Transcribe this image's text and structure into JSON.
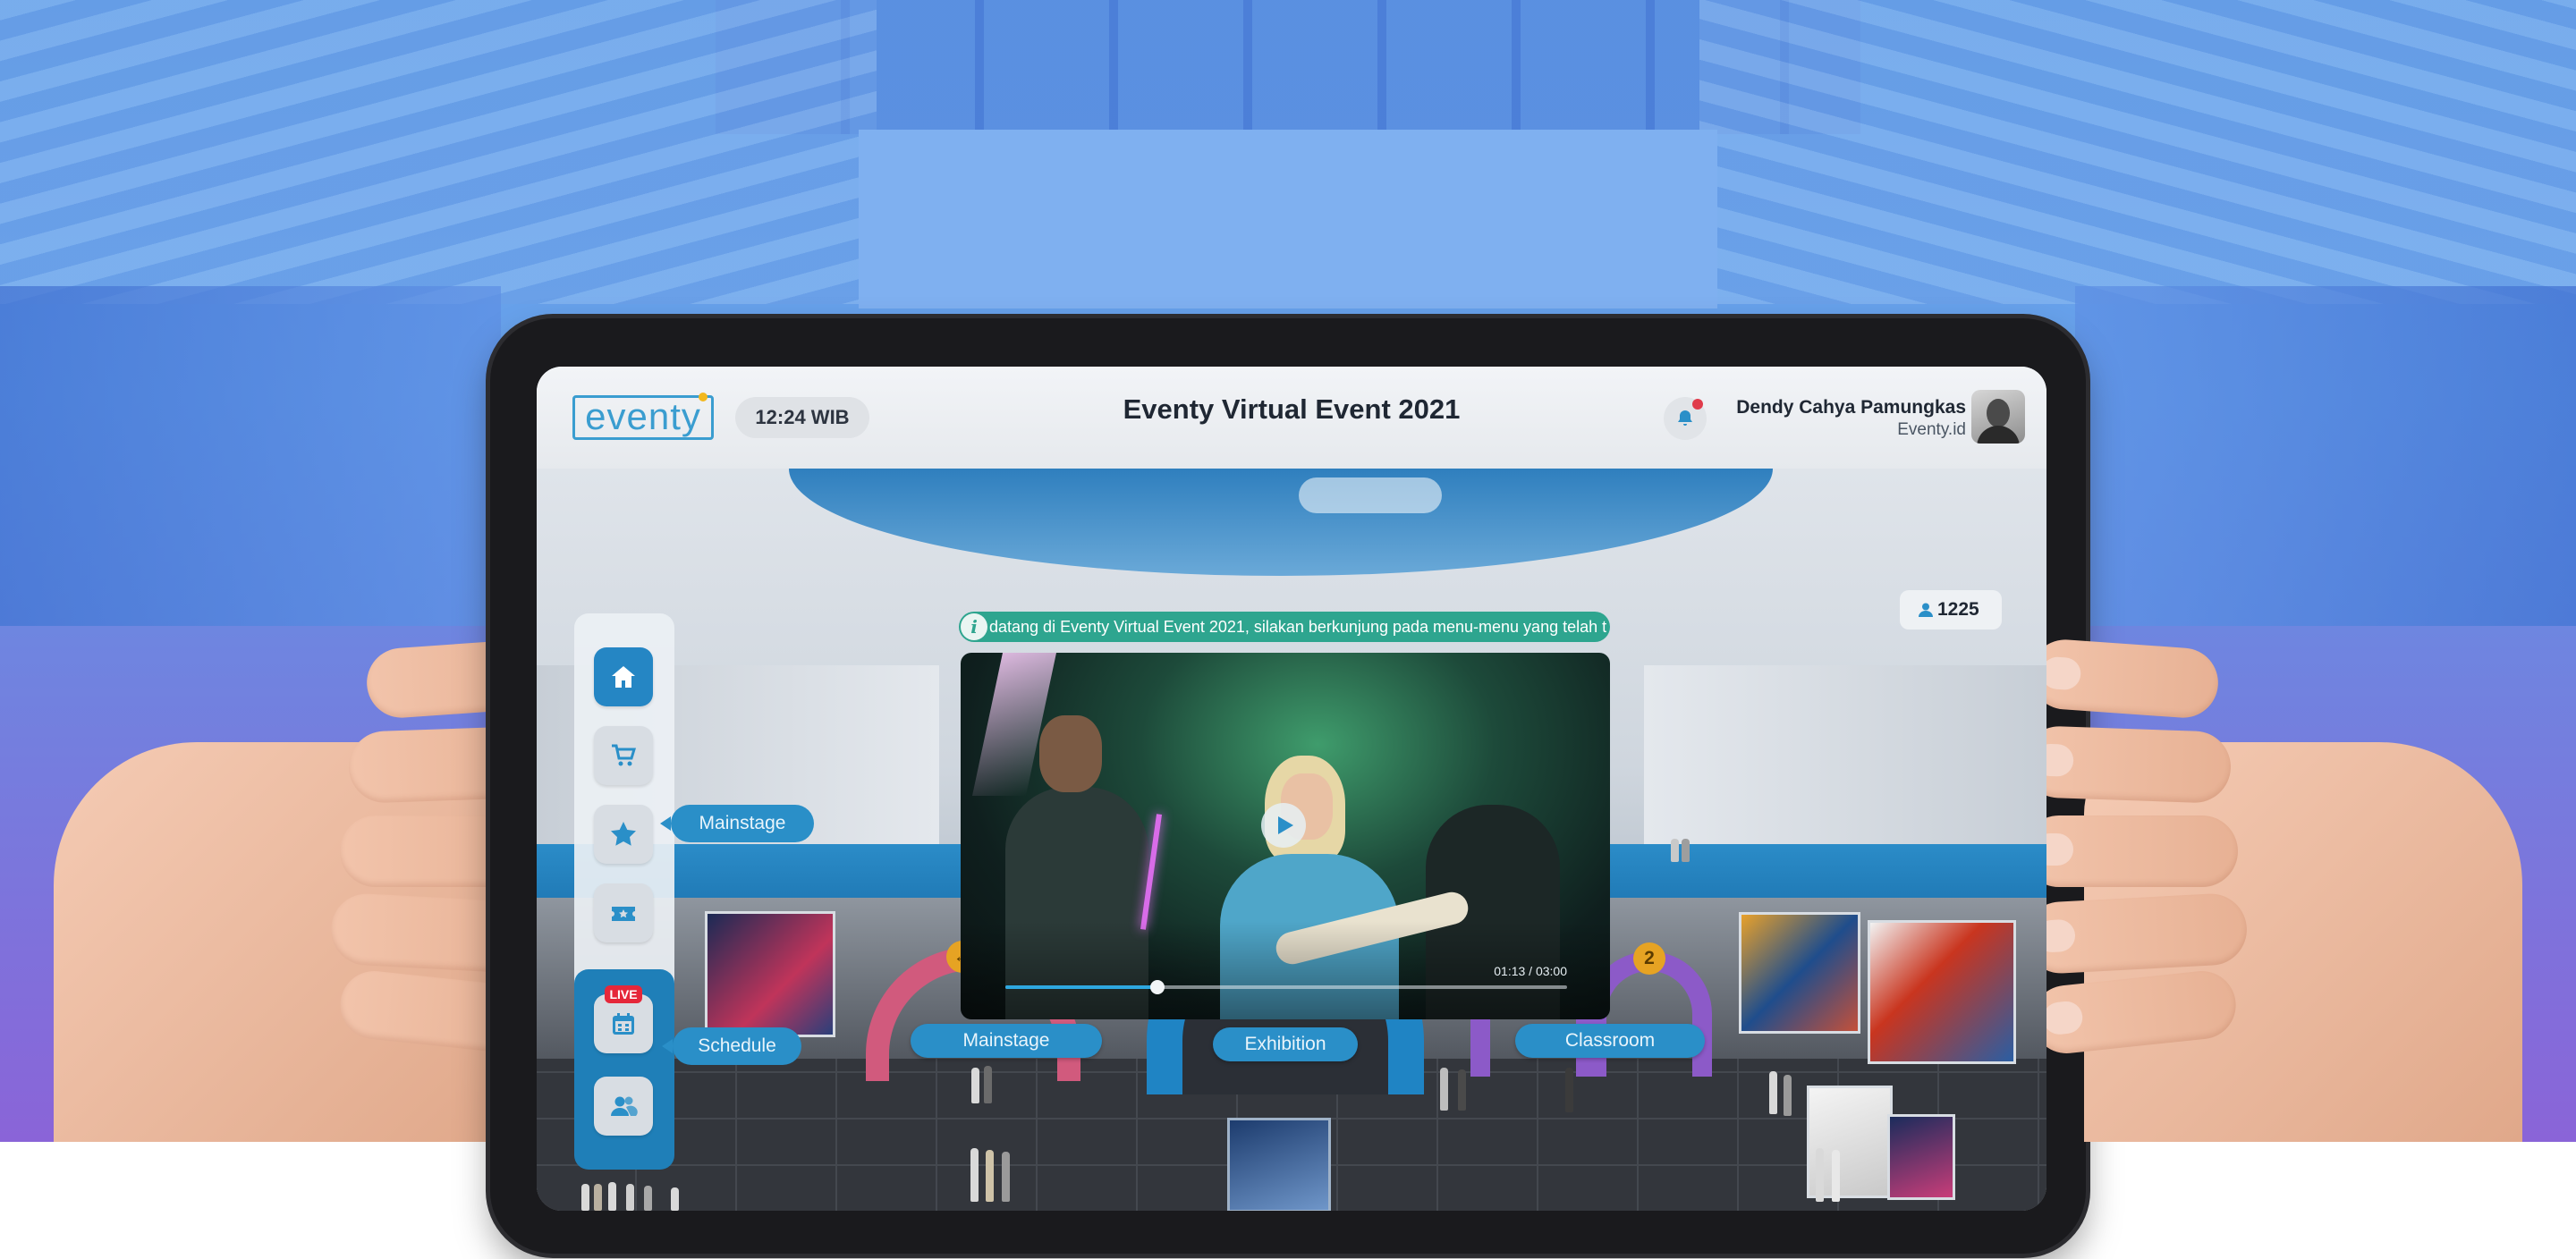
{
  "header": {
    "logo_text": "eventy",
    "clock": "12:24 WIB",
    "title": "Eventy Virtual Event 2021",
    "user_name": "Dendy Cahya Pamungkas",
    "user_org": "Eventy.id"
  },
  "sidebar": {
    "items": [
      {
        "name": "home",
        "icon": "home-icon",
        "active": true
      },
      {
        "name": "shop",
        "icon": "cart-icon",
        "active": false
      },
      {
        "name": "mainstage",
        "icon": "star-icon",
        "active": false,
        "tooltip": "Mainstage"
      },
      {
        "name": "ticket",
        "icon": "ticket-icon",
        "active": false
      },
      {
        "name": "schedule",
        "icon": "calendar-icon",
        "active": false,
        "tooltip": "Schedule",
        "badge": "LIVE"
      },
      {
        "name": "networking",
        "icon": "users-icon",
        "active": false
      }
    ]
  },
  "counter": {
    "icon": "user-icon",
    "value": "1225"
  },
  "ticker": {
    "text": "datang di Eventy Virtual Event 2021, silakan berkunjung pada menu-menu yang telah t"
  },
  "video": {
    "timecode": "01:13 / 03:00",
    "progress": 0.27
  },
  "venue": {
    "areas": [
      {
        "label": "Mainstage"
      },
      {
        "label": "Exhibition"
      },
      {
        "label": "Classroom"
      }
    ],
    "classroom_badges": [
      "1",
      "2"
    ]
  },
  "colors": {
    "accent": "#2a8fc8",
    "ticker": "#2ea58f",
    "live": "#e5273a",
    "notification": "#e03b4b"
  }
}
